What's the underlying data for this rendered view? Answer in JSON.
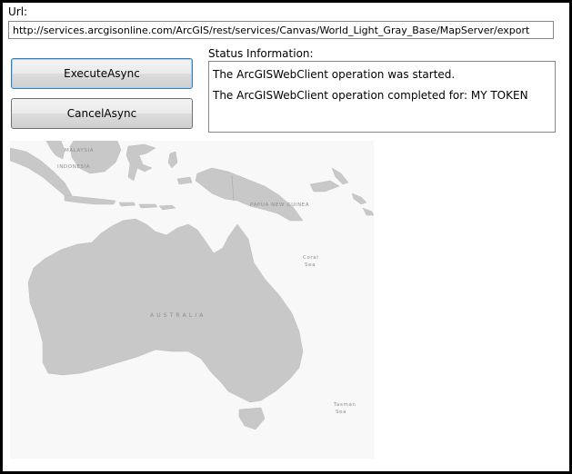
{
  "url": {
    "label": "Url:",
    "value": "http://services.arcgisonline.com/ArcGIS/rest/services/Canvas/World_Light_Gray_Base/MapServer/export"
  },
  "buttons": {
    "execute_label": "ExecuteAsync",
    "cancel_label": "CancelAsync"
  },
  "status": {
    "label": "Status Information:",
    "lines": [
      "The ArcGISWebClient operation was started.",
      "The ArcGISWebClient operation completed for: MY TOKEN"
    ]
  },
  "map": {
    "labels": {
      "malaysia": "MALAYSIA",
      "indonesia": "INDONESIA",
      "papua_new_guinea": "PAPUA NEW GUINEA",
      "australia": "A U S T R A L I A",
      "coral_sea_1": "Coral",
      "coral_sea_2": "Sea",
      "tasman_sea_1": "Tasman",
      "tasman_sea_2": "Sea"
    },
    "colors": {
      "water": "#f8f8f8",
      "land": "#c8c8c8",
      "border": "#a6a6a6",
      "label": "#8c8c8c"
    }
  }
}
